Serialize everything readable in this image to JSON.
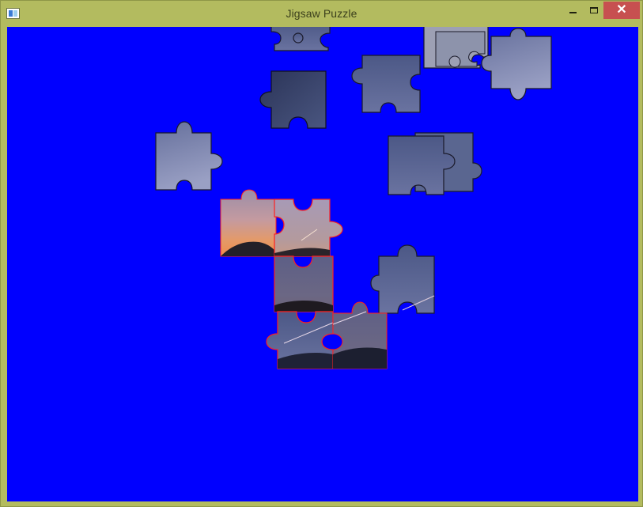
{
  "window": {
    "title": "Jigsaw Puzzle",
    "close_glyph": "✕"
  },
  "colors": {
    "board_background": "#0000ff",
    "frame": "#b3bb5f",
    "close_button": "#c75050",
    "selected_outline": "#ff2020",
    "piece_outline": "#222222"
  },
  "icons": {
    "app": "app-icon",
    "minimize": "minimize-icon",
    "maximize": "maximize-icon",
    "close": "close-icon"
  }
}
